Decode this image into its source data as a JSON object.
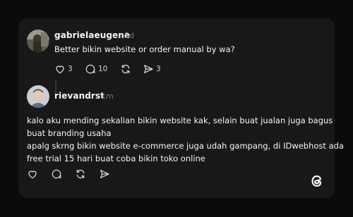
{
  "post1": {
    "username": "gabrielaeugene",
    "time": "5d",
    "text": "Better bikin website or order manual by wa?",
    "likes": "3",
    "replies": "10",
    "shares": "3"
  },
  "post2": {
    "username": "rievandrst",
    "time": "1m",
    "lines": [
      "kalo aku mending sekalian bikin website kak, selain buat jualan juga bagus",
      "buat branding usaha",
      "apalg skrng bikin website e-commerce juga udah gampang, di IDwebhost ada",
      "free trial 15 hari buat coba bikin toko online"
    ]
  },
  "icons": {
    "like": "heart-icon",
    "reply": "comment-icon",
    "repost": "repost-icon",
    "share": "send-icon",
    "brand": "threads-logo-icon"
  },
  "colors": {
    "background": "#0b0b0b",
    "card": "#181818",
    "text": "#f3f5f7",
    "muted": "#777777"
  }
}
